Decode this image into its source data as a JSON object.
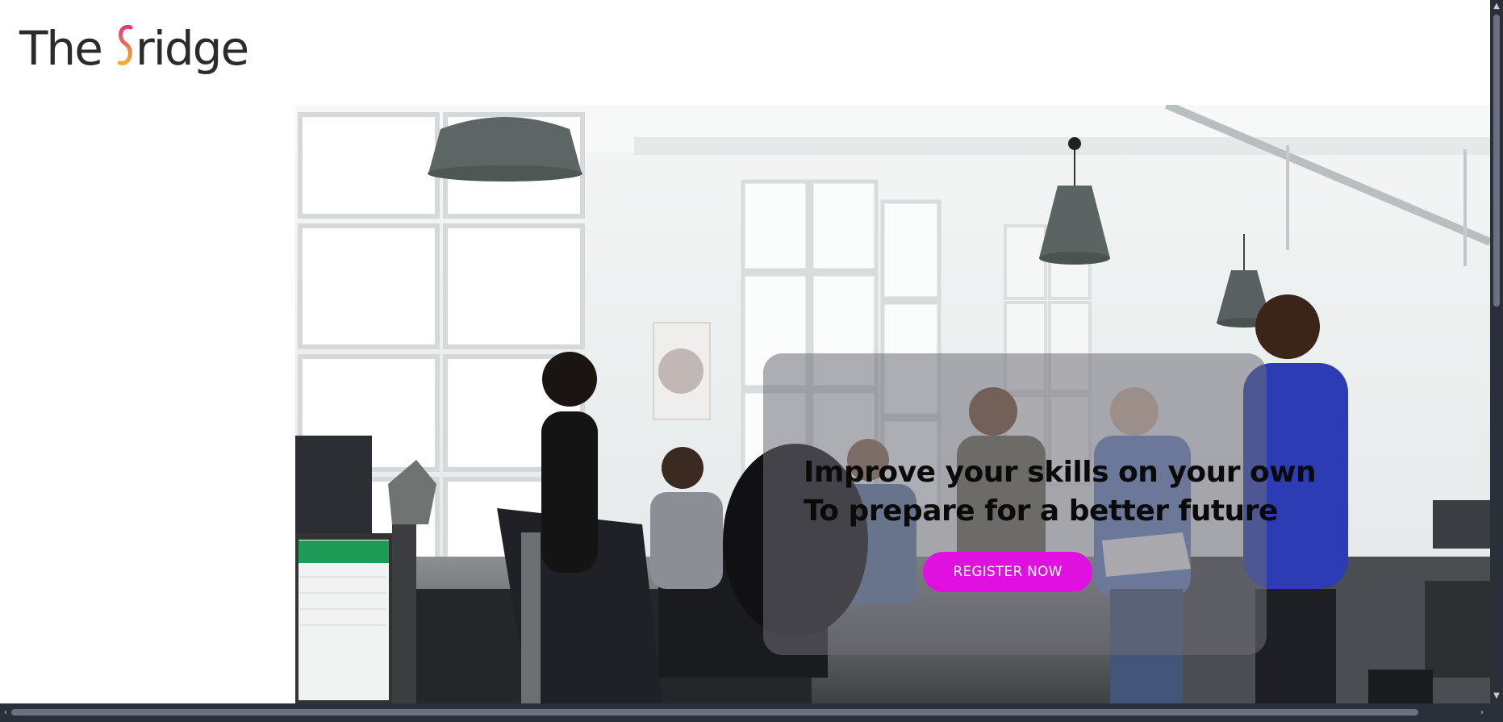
{
  "header": {
    "logo": {
      "word_the": "The",
      "word_ridge": "ridge",
      "icon": "stylized-b-icon"
    }
  },
  "hero": {
    "image": "office-team-meeting-photo",
    "headline_line_1": "Improve your skills on your own",
    "headline_line_2": "To prepare for a better future",
    "cta_label": "REGISTER NOW"
  },
  "colors": {
    "accent": "#e010e0",
    "logo_gradient_top": "#e8357a",
    "logo_gradient_bottom": "#f3b02a",
    "text_dark": "#2b2b2b",
    "scrollbar": "#2b2f3a"
  }
}
